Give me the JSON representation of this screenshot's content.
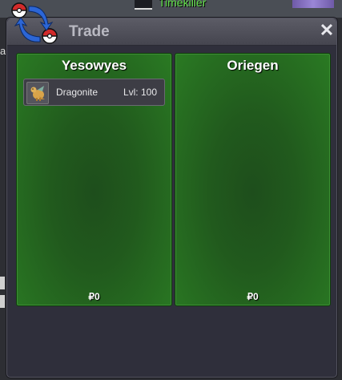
{
  "background": {
    "player_name": "Timekiller",
    "left_letter": "a"
  },
  "window": {
    "title": "Trade",
    "close_label": "✕"
  },
  "traders": [
    {
      "name": "Yesowyes",
      "money": "₽0",
      "items": [
        {
          "name": "Dragonite",
          "level": "Lvl: 100",
          "icon": "dragonite-sprite-icon"
        }
      ]
    },
    {
      "name": "Oriegen",
      "money": "₽0",
      "items": []
    }
  ],
  "colors": {
    "panel_green": "#21591d",
    "window_bg": "#2f2f3b",
    "title_text": "#b9b9c2"
  }
}
